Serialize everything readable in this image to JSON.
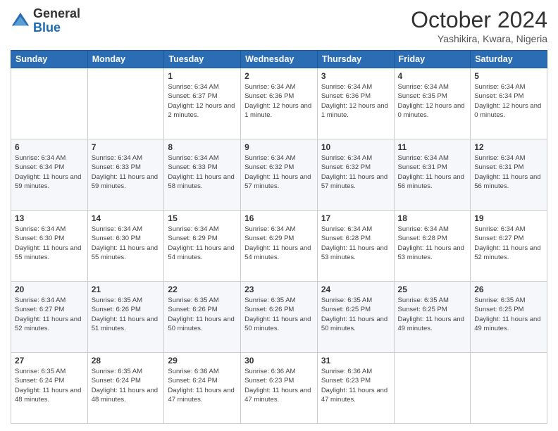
{
  "header": {
    "logo_general": "General",
    "logo_blue": "Blue",
    "title": "October 2024",
    "location": "Yashikira, Kwara, Nigeria"
  },
  "days_of_week": [
    "Sunday",
    "Monday",
    "Tuesday",
    "Wednesday",
    "Thursday",
    "Friday",
    "Saturday"
  ],
  "weeks": [
    [
      {
        "day": "",
        "sunrise": "",
        "sunset": "",
        "daylight": ""
      },
      {
        "day": "",
        "sunrise": "",
        "sunset": "",
        "daylight": ""
      },
      {
        "day": "1",
        "sunrise": "Sunrise: 6:34 AM",
        "sunset": "Sunset: 6:37 PM",
        "daylight": "Daylight: 12 hours and 2 minutes."
      },
      {
        "day": "2",
        "sunrise": "Sunrise: 6:34 AM",
        "sunset": "Sunset: 6:36 PM",
        "daylight": "Daylight: 12 hours and 1 minute."
      },
      {
        "day": "3",
        "sunrise": "Sunrise: 6:34 AM",
        "sunset": "Sunset: 6:36 PM",
        "daylight": "Daylight: 12 hours and 1 minute."
      },
      {
        "day": "4",
        "sunrise": "Sunrise: 6:34 AM",
        "sunset": "Sunset: 6:35 PM",
        "daylight": "Daylight: 12 hours and 0 minutes."
      },
      {
        "day": "5",
        "sunrise": "Sunrise: 6:34 AM",
        "sunset": "Sunset: 6:34 PM",
        "daylight": "Daylight: 12 hours and 0 minutes."
      }
    ],
    [
      {
        "day": "6",
        "sunrise": "Sunrise: 6:34 AM",
        "sunset": "Sunset: 6:34 PM",
        "daylight": "Daylight: 11 hours and 59 minutes."
      },
      {
        "day": "7",
        "sunrise": "Sunrise: 6:34 AM",
        "sunset": "Sunset: 6:33 PM",
        "daylight": "Daylight: 11 hours and 59 minutes."
      },
      {
        "day": "8",
        "sunrise": "Sunrise: 6:34 AM",
        "sunset": "Sunset: 6:33 PM",
        "daylight": "Daylight: 11 hours and 58 minutes."
      },
      {
        "day": "9",
        "sunrise": "Sunrise: 6:34 AM",
        "sunset": "Sunset: 6:32 PM",
        "daylight": "Daylight: 11 hours and 57 minutes."
      },
      {
        "day": "10",
        "sunrise": "Sunrise: 6:34 AM",
        "sunset": "Sunset: 6:32 PM",
        "daylight": "Daylight: 11 hours and 57 minutes."
      },
      {
        "day": "11",
        "sunrise": "Sunrise: 6:34 AM",
        "sunset": "Sunset: 6:31 PM",
        "daylight": "Daylight: 11 hours and 56 minutes."
      },
      {
        "day": "12",
        "sunrise": "Sunrise: 6:34 AM",
        "sunset": "Sunset: 6:31 PM",
        "daylight": "Daylight: 11 hours and 56 minutes."
      }
    ],
    [
      {
        "day": "13",
        "sunrise": "Sunrise: 6:34 AM",
        "sunset": "Sunset: 6:30 PM",
        "daylight": "Daylight: 11 hours and 55 minutes."
      },
      {
        "day": "14",
        "sunrise": "Sunrise: 6:34 AM",
        "sunset": "Sunset: 6:30 PM",
        "daylight": "Daylight: 11 hours and 55 minutes."
      },
      {
        "day": "15",
        "sunrise": "Sunrise: 6:34 AM",
        "sunset": "Sunset: 6:29 PM",
        "daylight": "Daylight: 11 hours and 54 minutes."
      },
      {
        "day": "16",
        "sunrise": "Sunrise: 6:34 AM",
        "sunset": "Sunset: 6:29 PM",
        "daylight": "Daylight: 11 hours and 54 minutes."
      },
      {
        "day": "17",
        "sunrise": "Sunrise: 6:34 AM",
        "sunset": "Sunset: 6:28 PM",
        "daylight": "Daylight: 11 hours and 53 minutes."
      },
      {
        "day": "18",
        "sunrise": "Sunrise: 6:34 AM",
        "sunset": "Sunset: 6:28 PM",
        "daylight": "Daylight: 11 hours and 53 minutes."
      },
      {
        "day": "19",
        "sunrise": "Sunrise: 6:34 AM",
        "sunset": "Sunset: 6:27 PM",
        "daylight": "Daylight: 11 hours and 52 minutes."
      }
    ],
    [
      {
        "day": "20",
        "sunrise": "Sunrise: 6:34 AM",
        "sunset": "Sunset: 6:27 PM",
        "daylight": "Daylight: 11 hours and 52 minutes."
      },
      {
        "day": "21",
        "sunrise": "Sunrise: 6:35 AM",
        "sunset": "Sunset: 6:26 PM",
        "daylight": "Daylight: 11 hours and 51 minutes."
      },
      {
        "day": "22",
        "sunrise": "Sunrise: 6:35 AM",
        "sunset": "Sunset: 6:26 PM",
        "daylight": "Daylight: 11 hours and 50 minutes."
      },
      {
        "day": "23",
        "sunrise": "Sunrise: 6:35 AM",
        "sunset": "Sunset: 6:26 PM",
        "daylight": "Daylight: 11 hours and 50 minutes."
      },
      {
        "day": "24",
        "sunrise": "Sunrise: 6:35 AM",
        "sunset": "Sunset: 6:25 PM",
        "daylight": "Daylight: 11 hours and 50 minutes."
      },
      {
        "day": "25",
        "sunrise": "Sunrise: 6:35 AM",
        "sunset": "Sunset: 6:25 PM",
        "daylight": "Daylight: 11 hours and 49 minutes."
      },
      {
        "day": "26",
        "sunrise": "Sunrise: 6:35 AM",
        "sunset": "Sunset: 6:25 PM",
        "daylight": "Daylight: 11 hours and 49 minutes."
      }
    ],
    [
      {
        "day": "27",
        "sunrise": "Sunrise: 6:35 AM",
        "sunset": "Sunset: 6:24 PM",
        "daylight": "Daylight: 11 hours and 48 minutes."
      },
      {
        "day": "28",
        "sunrise": "Sunrise: 6:35 AM",
        "sunset": "Sunset: 6:24 PM",
        "daylight": "Daylight: 11 hours and 48 minutes."
      },
      {
        "day": "29",
        "sunrise": "Sunrise: 6:36 AM",
        "sunset": "Sunset: 6:24 PM",
        "daylight": "Daylight: 11 hours and 47 minutes."
      },
      {
        "day": "30",
        "sunrise": "Sunrise: 6:36 AM",
        "sunset": "Sunset: 6:23 PM",
        "daylight": "Daylight: 11 hours and 47 minutes."
      },
      {
        "day": "31",
        "sunrise": "Sunrise: 6:36 AM",
        "sunset": "Sunset: 6:23 PM",
        "daylight": "Daylight: 11 hours and 47 minutes."
      },
      {
        "day": "",
        "sunrise": "",
        "sunset": "",
        "daylight": ""
      },
      {
        "day": "",
        "sunrise": "",
        "sunset": "",
        "daylight": ""
      }
    ]
  ]
}
